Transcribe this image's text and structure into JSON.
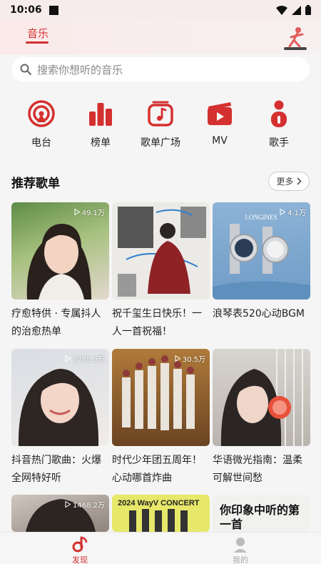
{
  "status_bar": {
    "time": "10:06"
  },
  "top_nav": {
    "tab_label": "音乐"
  },
  "search": {
    "placeholder": "搜索你想听的音乐"
  },
  "quick_entries": [
    {
      "label": "电台",
      "icon": "radio-icon"
    },
    {
      "label": "榜单",
      "icon": "chart-icon"
    },
    {
      "label": "歌单广场",
      "icon": "playlist-icon"
    },
    {
      "label": "MV",
      "icon": "video-icon"
    },
    {
      "label": "歌手",
      "icon": "singer-icon"
    }
  ],
  "section": {
    "title": "推荐歌单",
    "more_label": "更多"
  },
  "playlists": [
    {
      "title": "疗愈特供 · 专属抖人的治愈热单",
      "plays": "49.1万"
    },
    {
      "title": "祝千玺生日快乐！一人一首祝福！",
      "plays": ""
    },
    {
      "title": "浪琴表520心动BGM",
      "plays": "4.1万",
      "cover_text": "LONGINES"
    },
    {
      "title": "抖音热门歌曲：火爆全网特好听",
      "plays": "2785.5万"
    },
    {
      "title": "时代少年团五周年！心动哪首炸曲",
      "plays": "30.5万"
    },
    {
      "title": "华语微光指南：温柔可解世间愁",
      "plays": ""
    },
    {
      "title": "",
      "plays": "1468.2万"
    },
    {
      "title": "",
      "plays": "",
      "cover_text": "2024 WayV CONCERT"
    },
    {
      "title": "",
      "plays": "",
      "cover_text": "你印象中听的第一首"
    }
  ],
  "bottom_nav": {
    "discover": "发现",
    "mine": "我的"
  },
  "colors": {
    "accent": "#d4302f"
  }
}
